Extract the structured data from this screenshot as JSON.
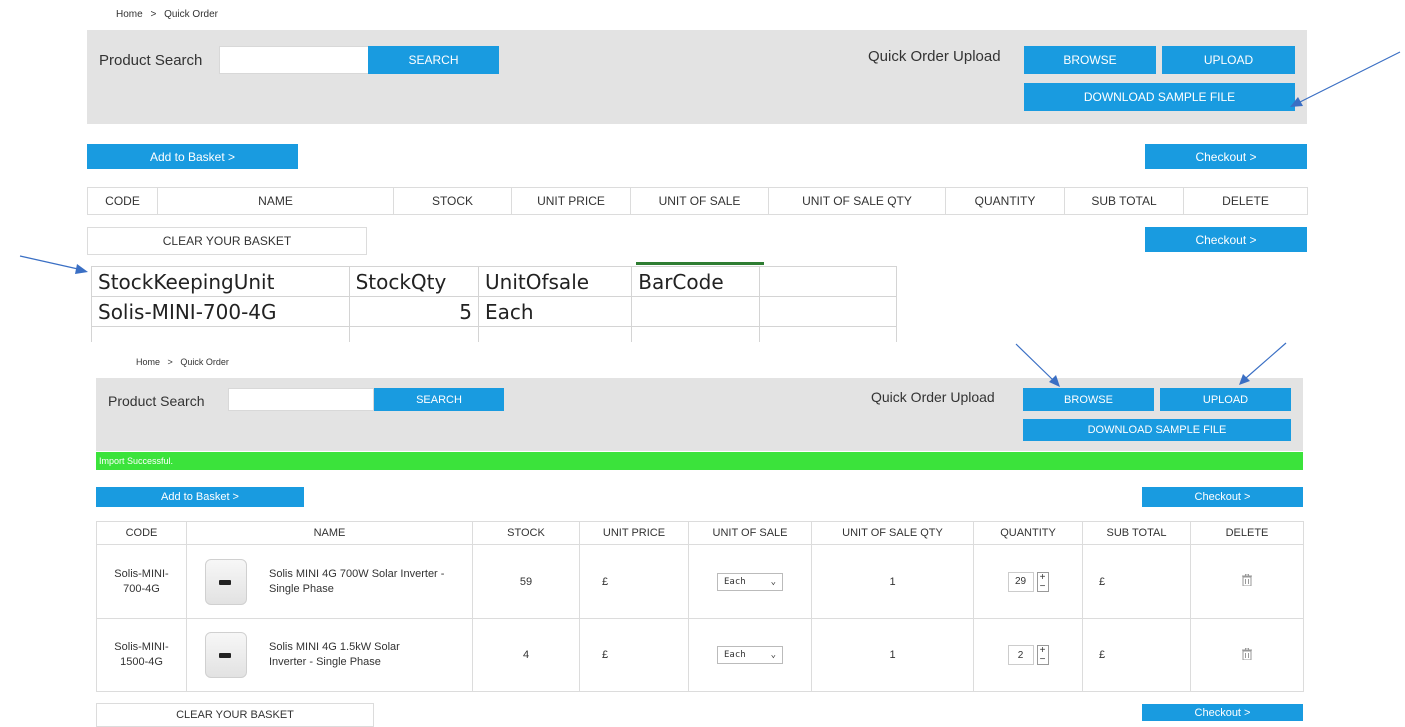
{
  "top": {
    "breadcrumb": {
      "home": "Home",
      "sep": ">",
      "current": "Quick Order"
    },
    "search_label": "Product Search",
    "search_button": "SEARCH",
    "upload_label": "Quick Order Upload",
    "browse_button": "BROWSE",
    "upload_button": "UPLOAD",
    "download_button": "DOWNLOAD SAMPLE FILE",
    "add_to_basket": "Add to Basket >",
    "checkout": "Checkout >",
    "columns": [
      "CODE",
      "NAME",
      "STOCK",
      "UNIT PRICE",
      "UNIT OF SALE",
      "UNIT OF SALE QTY",
      "QUANTITY",
      "SUB TOTAL",
      "DELETE"
    ],
    "clear_basket": "CLEAR YOUR BASKET"
  },
  "excel": {
    "headers": [
      "StockKeepingUnit",
      "StockQty",
      "UnitOfsale",
      "BarCode"
    ],
    "row": [
      "Solis-MINI-700-4G",
      "5",
      "Each",
      ""
    ]
  },
  "bottom": {
    "breadcrumb": {
      "home": "Home",
      "sep": ">",
      "current": "Quick Order"
    },
    "search_label": "Product Search",
    "search_button": "SEARCH",
    "upload_label": "Quick Order Upload",
    "browse_button": "BROWSE",
    "upload_button": "UPLOAD",
    "download_button": "DOWNLOAD SAMPLE FILE",
    "status_message": "Import Successful.",
    "add_to_basket": "Add to Basket >",
    "checkout": "Checkout >",
    "columns": [
      "CODE",
      "NAME",
      "STOCK",
      "UNIT PRICE",
      "UNIT OF SALE",
      "UNIT OF SALE QTY",
      "QUANTITY",
      "SUB TOTAL",
      "DELETE"
    ],
    "rows": [
      {
        "code": "Solis-MINI-700-4G",
        "name": "Solis MINI 4G 700W Solar Inverter - Single Phase",
        "stock": "59",
        "unit_price": "£",
        "unit_of_sale": "Each",
        "unit_of_sale_qty": "1",
        "quantity": "29",
        "sub_total": "£"
      },
      {
        "code": "Solis-MINI-1500-4G",
        "name": "Solis MINI 4G 1.5kW Solar Inverter - Single Phase",
        "stock": "4",
        "unit_price": "£",
        "unit_of_sale": "Each",
        "unit_of_sale_qty": "1",
        "quantity": "2",
        "sub_total": "£"
      }
    ],
    "clear_basket": "CLEAR YOUR BASKET"
  },
  "colors": {
    "accent_blue": "#199be0",
    "panel_gray": "#e3e3e3",
    "success_green": "#3be33b",
    "arrow_blue": "#3a6fc4",
    "stock_green": "#6a9e3a"
  },
  "icons": {
    "delete": "trash-icon",
    "stepper": "plus-minus-stepper-icon",
    "dropdown": "chevron-down-icon"
  }
}
